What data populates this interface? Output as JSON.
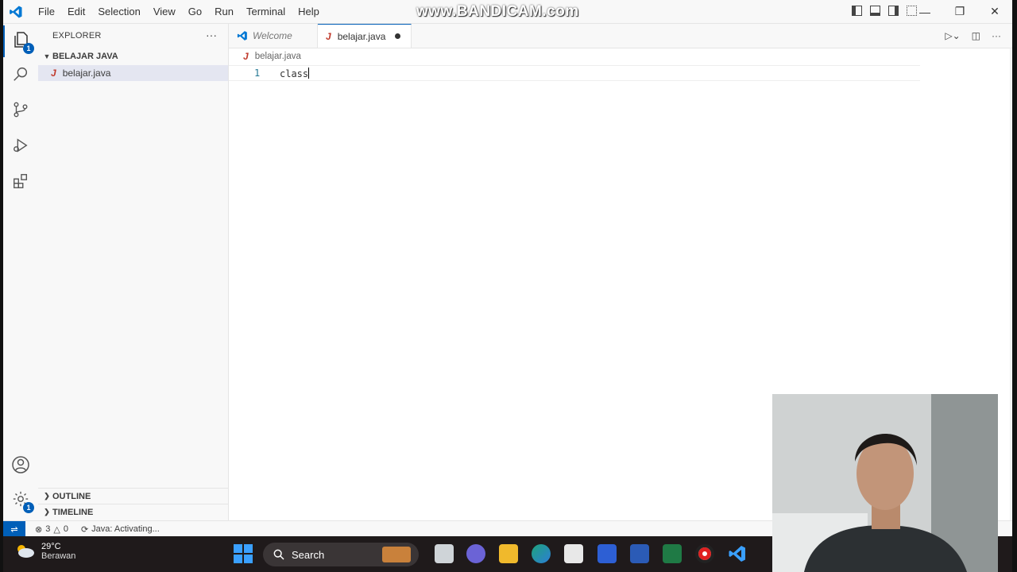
{
  "window": {
    "title_overlay": "www.BANDICAM.com",
    "menu": [
      "File",
      "Edit",
      "Selection",
      "View",
      "Go",
      "Run",
      "Terminal",
      "Help"
    ]
  },
  "activity_bar": {
    "explorer_badge": "1",
    "manage_badge": "1"
  },
  "sidebar": {
    "title": "EXPLORER",
    "more": "···",
    "folder": "BELAJAR JAVA",
    "files": [
      {
        "icon": "J",
        "name": "belajar.java"
      }
    ],
    "outline": "OUTLINE",
    "timeline": "TIMELINE"
  },
  "tabs": [
    {
      "label": "Welcome",
      "active": false
    },
    {
      "label": "belajar.java",
      "active": true,
      "dirty": true
    }
  ],
  "breadcrumb": {
    "icon": "J",
    "file": "belajar.java"
  },
  "editor": {
    "lines": [
      {
        "number": "1",
        "text": "class"
      }
    ]
  },
  "status": {
    "errors": "3",
    "warnings": "0",
    "java": "Java: Activating..."
  },
  "taskbar": {
    "temperature": "29°C",
    "condition": "Berawan",
    "search_label": "Search"
  },
  "colors": {
    "accent": "#005fb8",
    "java_icon": "#c0392b",
    "taskbar": "#1f1a1b"
  }
}
